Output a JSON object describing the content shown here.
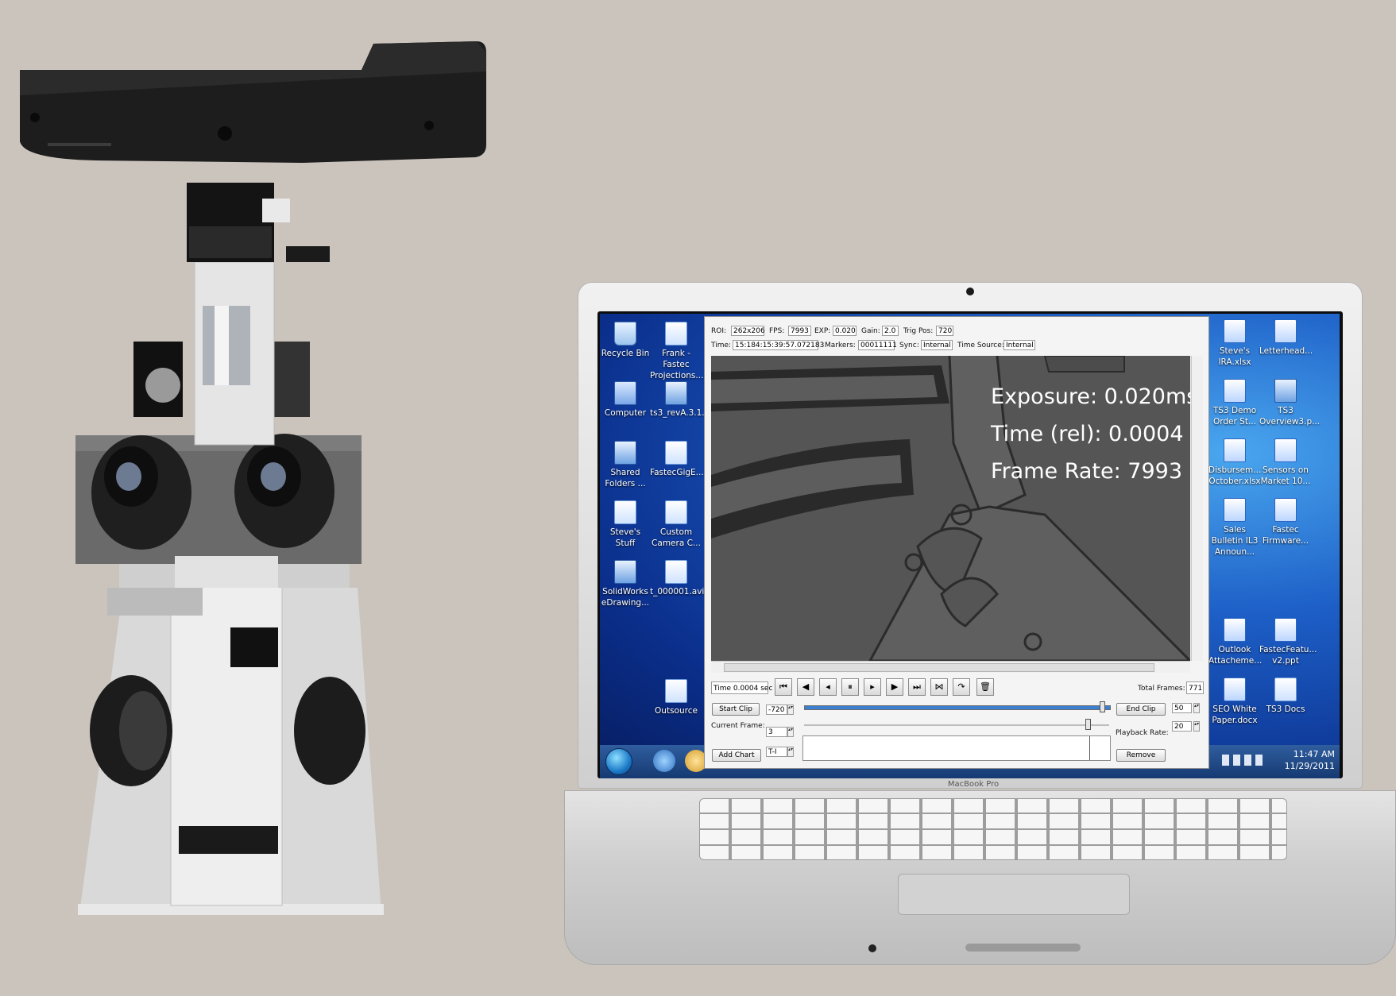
{
  "laptop": {
    "brand_label": "MacBook Pro"
  },
  "desktop_icons_left": [
    {
      "label": "Recycle Bin",
      "icon": "recycle-bin-icon",
      "kind": "bin"
    },
    {
      "label": "Frank - Fastec Projections...",
      "icon": "document-icon",
      "kind": "doc"
    },
    {
      "label": "Computer",
      "icon": "computer-icon",
      "kind": "pc"
    },
    {
      "label": "ts3_revA.3.1...",
      "icon": "app-shortcut-icon",
      "kind": "app"
    },
    {
      "label": "Shared Folders ...",
      "icon": "shared-folder-icon",
      "kind": "app"
    },
    {
      "label": "FastecGigE...",
      "icon": "document-icon",
      "kind": "doc"
    },
    {
      "label": "Steve's Stuff",
      "icon": "folder-icon",
      "kind": "doc"
    },
    {
      "label": "Custom Camera C...",
      "icon": "document-icon",
      "kind": "doc"
    },
    {
      "label": "SolidWorks eDrawing...",
      "icon": "edrawings-icon",
      "kind": "app"
    },
    {
      "label": "t_000001.avi",
      "icon": "video-file-icon",
      "kind": "doc"
    },
    {
      "label": "Outsource",
      "icon": "folder-icon",
      "kind": "doc"
    }
  ],
  "desktop_icons_right": [
    {
      "label": "Steve's IRA.xlsx",
      "icon": "spreadsheet-icon",
      "kind": "word"
    },
    {
      "label": "Letterhead...",
      "icon": "word-document-icon",
      "kind": "word"
    },
    {
      "label": "TS3 Demo Order St...",
      "icon": "word-document-icon",
      "kind": "word"
    },
    {
      "label": "TS3 Overview3.p...",
      "icon": "presentation-icon",
      "kind": "app"
    },
    {
      "label": "Disbursem... October.xlsx",
      "icon": "spreadsheet-icon",
      "kind": "word"
    },
    {
      "label": "Sensors on Market 10...",
      "icon": "word-document-icon",
      "kind": "word"
    },
    {
      "label": "Sales Bulletin IL3 Announ...",
      "icon": "word-document-icon",
      "kind": "word"
    },
    {
      "label": "Fastec Firmware...",
      "icon": "word-document-icon",
      "kind": "word"
    },
    {
      "label": "Outlook Attacheme...",
      "icon": "word-document-icon",
      "kind": "word"
    },
    {
      "label": "FastecFeatu... v2.ppt",
      "icon": "presentation-icon",
      "kind": "word"
    },
    {
      "label": "SEO White Paper.docx",
      "icon": "word-document-icon",
      "kind": "word"
    },
    {
      "label": "TS3 Docs",
      "icon": "folder-icon",
      "kind": "doc"
    }
  ],
  "taskbar": {
    "time": "11:47 AM",
    "date": "11/29/2011"
  },
  "app": {
    "info_row1": {
      "roi_label": "ROI:",
      "roi": "262x206",
      "fps_label": "FPS:",
      "fps": "7993",
      "exp_label": "EXP:",
      "exp": "0.020",
      "gain_label": "Gain:",
      "gain": "2.0",
      "trig_label": "Trig Pos:",
      "trig": "720"
    },
    "info_row2": {
      "time_label": "Time:",
      "time": "15:184:15:39:57.072183",
      "markers_label": "Markers:",
      "markers": "00011111",
      "sync_label": "Sync:",
      "sync": "Internal",
      "source_label": "Time Source:",
      "source": "Internal"
    },
    "overlay": {
      "exposure": "Exposure:  0.020ms",
      "time_rel": "Time (rel): 0.0004",
      "frame_rate": "Frame Rate: 7993"
    },
    "playback": {
      "time_display": "Time 0.0004 sec",
      "total_frames_label": "Total Frames:",
      "total_frames": "771"
    },
    "clip": {
      "start_clip_label": "Start Clip",
      "start_value": "-720",
      "end_clip_label": "End Clip",
      "end_value": "50",
      "current_frame_label": "Current Frame:",
      "current_frame": "3",
      "playback_rate_label": "Playback Rate:",
      "playback_rate": "20",
      "add_chart_label": "Add Chart",
      "chart_value": "T-I",
      "remove_label": "Remove",
      "clip_position": 0.985,
      "frame_position": 0.94
    }
  }
}
